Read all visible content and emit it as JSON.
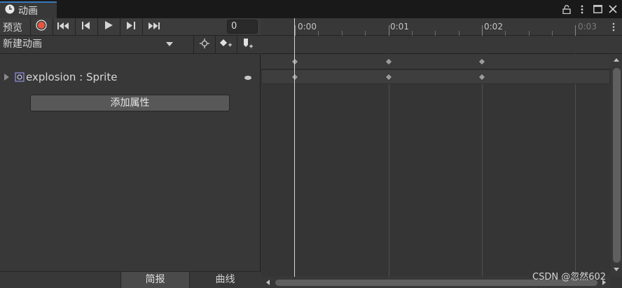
{
  "window": {
    "tab_title": "动画",
    "icons": [
      "lock-icon",
      "more-vert-icon",
      "maximize-icon",
      "close-icon"
    ]
  },
  "toolbar": {
    "preview_label": "预览",
    "frame_value": "0",
    "buttons": [
      "record-icon",
      "first-keyframe-icon",
      "prev-keyframe-icon",
      "play-icon",
      "next-keyframe-icon",
      "last-keyframe-icon"
    ],
    "record_color": "#e8553e"
  },
  "clip": {
    "selected": "新建动画",
    "buttons": [
      "snap-icon",
      "add-keyframe-icon",
      "add-event-icon"
    ]
  },
  "properties": [
    {
      "label": "explosion : Sprite",
      "icon": "sprite-icon"
    }
  ],
  "add_property_label": "添加属性",
  "bottom_tabs": {
    "dopesheet": "简报",
    "curves": "曲线"
  },
  "timeline": {
    "ticks": [
      "0:00",
      "0:01",
      "0:02",
      "0:03"
    ],
    "keyframe_times": [
      "0:00",
      "0:01",
      "0:02"
    ],
    "playhead_time": "0:00"
  },
  "watermark": "CSDN @忽然602"
}
